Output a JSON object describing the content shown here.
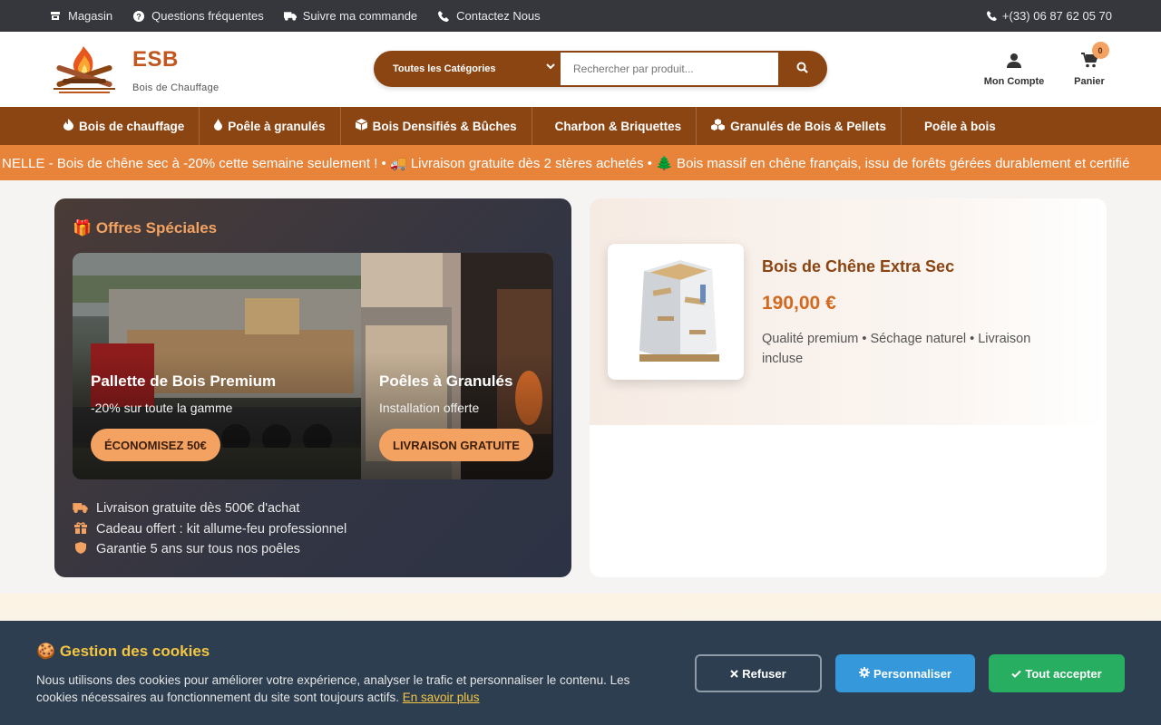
{
  "topbar": {
    "links": [
      {
        "label": "Magasin",
        "icon": "store-icon"
      },
      {
        "label": "Questions fréquentes",
        "icon": "question-circle-icon"
      },
      {
        "label": "Suivre ma commande",
        "icon": "truck-icon"
      },
      {
        "label": "Contactez Nous",
        "icon": "phone-icon"
      }
    ],
    "phone": "+(33) 06 87 62 05 70"
  },
  "brand": {
    "name": "ESB",
    "tagline": "Bois de Chauffage"
  },
  "search": {
    "category": "Toutes les Catégories",
    "placeholder": "Rechercher par produit..."
  },
  "account": {
    "label": "Mon Compte"
  },
  "cart": {
    "label": "Panier",
    "count": "0"
  },
  "nav": [
    {
      "label": "Bois de chauffage",
      "icon": "fire-icon"
    },
    {
      "label": "Poêle à granulés",
      "icon": "flame-drop-icon"
    },
    {
      "label": "Bois Densifiés & Bûches",
      "icon": "cube-icon"
    },
    {
      "label": "Charbon & Briquettes",
      "icon": ""
    },
    {
      "label": "Granulés de Bois & Pellets",
      "icon": "cubes-icon"
    },
    {
      "label": "Poêle à bois",
      "icon": ""
    }
  ],
  "ticker": "NELLE - Bois de chêne sec à -20% cette semaine seulement ! • 🚚 Livraison gratuite dès 2 stères achetés • 🌲 Bois massif en chêne français, issu de forêts gérées durablement et certifié",
  "offers": {
    "title": "🎁 Offres Spéciales",
    "promos": [
      {
        "title": "Pallette de Bois Premium",
        "subtitle": "-20% sur toute la gamme",
        "button": "ÉCONOMISEZ 50€"
      },
      {
        "title": "Poêles à Granulés",
        "subtitle": "Installation offerte",
        "button": "LIVRAISON GRATUITE"
      }
    ],
    "benefits": [
      {
        "text": "Livraison gratuite dès 500€ d'achat",
        "icon": "truck-icon"
      },
      {
        "text": "Cadeau offert : kit allume-feu professionnel",
        "icon": "gift-icon"
      },
      {
        "text": "Garantie 5 ans sur tous nos poêles",
        "icon": "shield-icon"
      }
    ]
  },
  "product": {
    "name": "Bois de Chêne Extra Sec",
    "price": "190,00 €",
    "description": "Qualité premium • Séchage naturel • Livraison incluse"
  },
  "cookies": {
    "title": "🍪 Gestion des cookies",
    "text": "Nous utilisons des cookies pour améliorer votre expérience, analyser le trafic et personnaliser le contenu. Les cookies nécessaires au fonctionnement du site sont toujours actifs.",
    "link": "En savoir plus",
    "refuse": "Refuser",
    "customize": "Personnaliser",
    "accept": "Tout accepter"
  },
  "colors": {
    "brand_brown": "#8b4513",
    "accent_orange": "#e8833a",
    "promo_orange": "#f4a261",
    "cookie_bg": "#2c3e50"
  }
}
